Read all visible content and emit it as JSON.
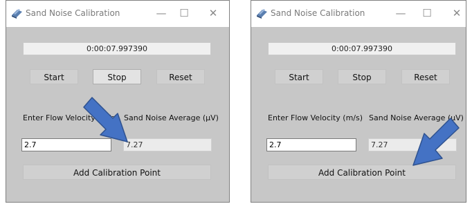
{
  "windows": [
    {
      "title": "Sand Noise Calibration",
      "timer": "0:00:07.997390",
      "buttons": {
        "start": "Start",
        "stop": "Stop",
        "reset": "Reset"
      },
      "labels": {
        "flow_velocity": "Enter Flow Velocity (m/s)",
        "sand_noise_avg": "Sand Noise Average (µV)"
      },
      "flow_velocity_value": "2.7",
      "sand_noise_avg_value": "7.27",
      "add_point": "Add Calibration Point"
    },
    {
      "title": "Sand Noise Calibration",
      "timer": "0:00:07.997390",
      "buttons": {
        "start": "Start",
        "stop": "Stop",
        "reset": "Reset"
      },
      "labels": {
        "flow_velocity": "Enter Flow Velocity (m/s)",
        "sand_noise_avg": "Sand Noise Average (µV)"
      },
      "flow_velocity_value": "2.7",
      "sand_noise_avg_value": "7.27",
      "add_point": "Add Calibration Point"
    }
  ],
  "window_controls": {
    "minimize": "—",
    "maximize": "☐",
    "close": "✕"
  },
  "colors": {
    "client_bg": "#c7c7c7",
    "titlebar_bg": "#ffffff",
    "arrow_fill": "#4472c4",
    "arrow_stroke": "#2f528f"
  },
  "annotations": [
    {
      "type": "arrow-icon",
      "color": "#4472c4"
    },
    {
      "type": "arrow-icon",
      "color": "#4472c4"
    }
  ]
}
